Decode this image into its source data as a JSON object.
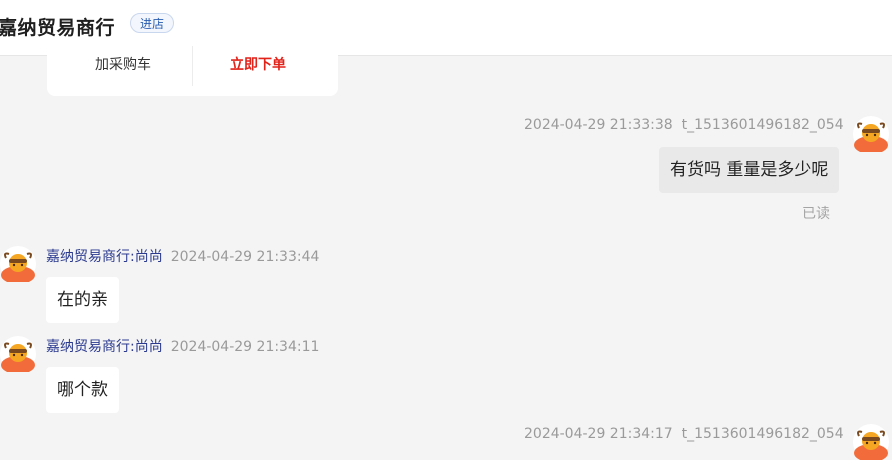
{
  "header": {
    "shop_name": "嘉纳贸易商行",
    "enter_store": "进店"
  },
  "product_card": {
    "add_to_cart": "加采购车",
    "order_now": "立即下单"
  },
  "messages": [
    {
      "side": "self",
      "time": "2024-04-29 21:33:38",
      "user": "t_1513601496182_054",
      "text": "有货吗 重量是多少呢",
      "read_status": "已读"
    },
    {
      "side": "other",
      "sender": "嘉纳贸易商行:尚尚",
      "time": "2024-04-29 21:33:44",
      "text": "在的亲"
    },
    {
      "side": "other",
      "sender": "嘉纳贸易商行:尚尚",
      "time": "2024-04-29 21:34:11",
      "text": "哪个款"
    },
    {
      "side": "self",
      "time": "2024-04-29 21:34:17",
      "user": "t_1513601496182_054"
    }
  ],
  "colors": {
    "accent_red": "#e2231a",
    "sender_blue": "#2b3a8f",
    "avatar_orange": "#f26b3a"
  }
}
